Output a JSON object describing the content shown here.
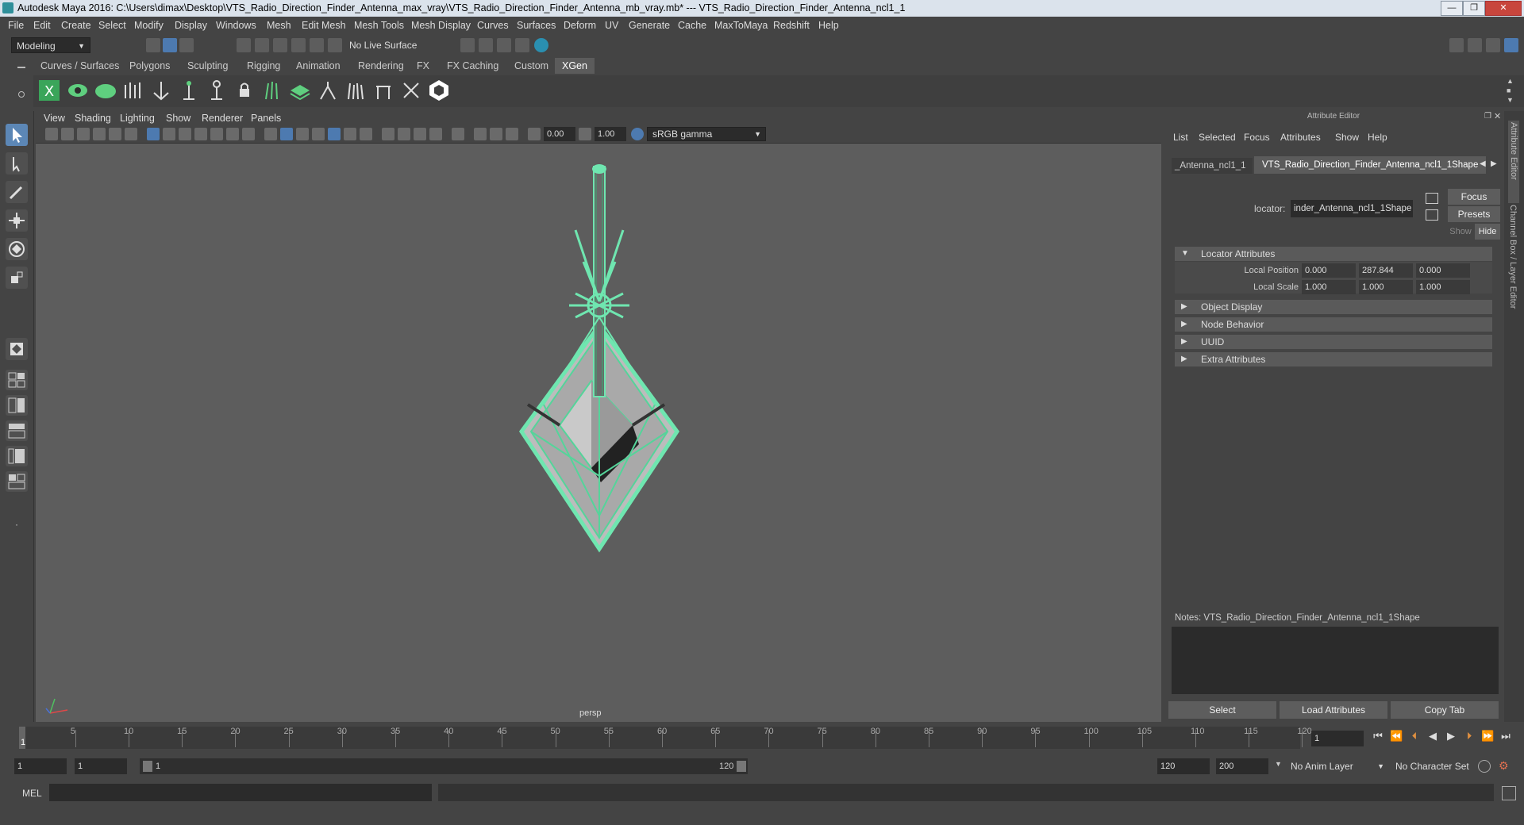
{
  "window": {
    "title": "Autodesk Maya 2016: C:\\Users\\dimax\\Desktop\\VTS_Radio_Direction_Finder_Antenna_max_vray\\VTS_Radio_Direction_Finder_Antenna_mb_vray.mb*   ---   VTS_Radio_Direction_Finder_Antenna_ncl1_1",
    "minimize": "—",
    "maximize": "❐",
    "close": "✕"
  },
  "menubar": [
    "File",
    "Edit",
    "Create",
    "Select",
    "Modify",
    "Display",
    "Windows",
    "Mesh",
    "Edit Mesh",
    "Mesh Tools",
    "Mesh Display",
    "Curves",
    "Surfaces",
    "Deform",
    "UV",
    "Generate",
    "Cache",
    "MaxToMaya",
    "Redshift",
    "Help"
  ],
  "statusline": {
    "mode": "Modeling",
    "live_surface": "No Live Surface"
  },
  "shelf_tabs": [
    "Curves / Surfaces",
    "Polygons",
    "Sculpting",
    "Rigging",
    "Animation",
    "Rendering",
    "FX",
    "FX Caching",
    "Custom",
    "XGen"
  ],
  "active_shelf_tab": "XGen",
  "viewport": {
    "menus": [
      "View",
      "Shading",
      "Lighting",
      "Show",
      "Renderer",
      "Panels"
    ],
    "exposure": "0.00",
    "gamma": "1.00",
    "color_space": "sRGB gamma",
    "camera_label": "persp"
  },
  "attribute_editor": {
    "title": "Attribute Editor",
    "menus": [
      "List",
      "Selected",
      "Focus",
      "Attributes",
      "Show",
      "Help"
    ],
    "tab_left": "_Antenna_ncl1_1",
    "tab_active": "VTS_Radio_Direction_Finder_Antenna_ncl1_1Shape",
    "locator_label": "locator:",
    "locator_value": "inder_Antenna_ncl1_1Shape",
    "focus_btn": "Focus",
    "presets_btn": "Presets",
    "show_btn": "Show",
    "hide_btn": "Hide",
    "sections": {
      "locator_attributes": "Locator Attributes",
      "local_position_label": "Local Position",
      "local_position": [
        "0.000",
        "287.844",
        "0.000"
      ],
      "local_scale_label": "Local Scale",
      "local_scale": [
        "1.000",
        "1.000",
        "1.000"
      ],
      "object_display": "Object Display",
      "node_behavior": "Node Behavior",
      "uuid": "UUID",
      "extra_attributes": "Extra Attributes"
    },
    "notes_label": "Notes:  VTS_Radio_Direction_Finder_Antenna_ncl1_1Shape",
    "buttons": {
      "select": "Select",
      "load": "Load Attributes",
      "copy": "Copy Tab"
    }
  },
  "side_tabs": [
    "Attribute Editor",
    "Channel Box / Layer Editor"
  ],
  "timeline": {
    "ticks": [
      "5",
      "10",
      "15",
      "20",
      "25",
      "30",
      "35",
      "40",
      "45",
      "50",
      "55",
      "60",
      "65",
      "70",
      "75",
      "80",
      "85",
      "90",
      "95",
      "100",
      "105",
      "110",
      "115",
      "120"
    ],
    "current_frame_marker": "1",
    "current_frame": "1"
  },
  "range": {
    "start": "1",
    "playback_start": "1",
    "slider_start": "1",
    "slider_end": "120",
    "playback_end": "120",
    "end": "200",
    "anim_layer": "No Anim Layer",
    "character_set": "No Character Set"
  },
  "cmdline": {
    "label": "MEL"
  }
}
